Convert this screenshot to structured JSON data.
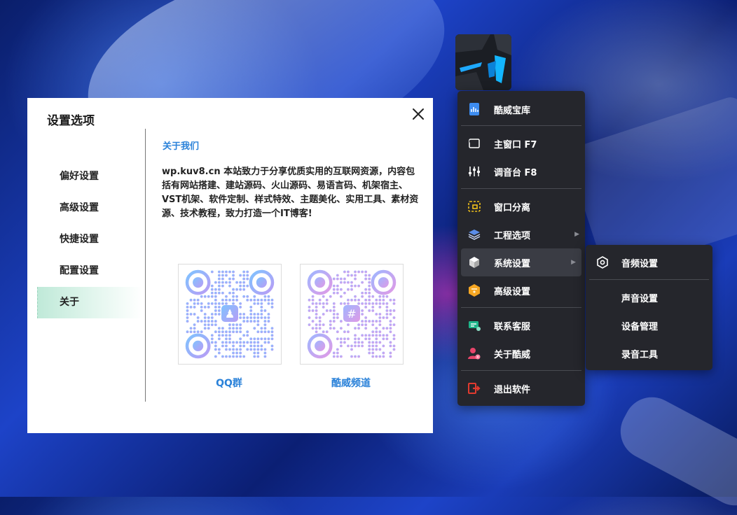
{
  "settings_dialog": {
    "title": "设置选项",
    "nav": [
      "偏好设置",
      "高级设置",
      "快捷设置",
      "配置设置",
      "关于"
    ],
    "active_nav": "关于",
    "about": {
      "heading": "关于我们",
      "text": "wp.kuv8.cn 本站致力于分享优质实用的互联网资源，内容包括有网站搭建、建站源码、火山源码、易语言码、机架宿主、VST机架、软件定制、样式特效、主题美化、实用工具、素材资源、技术教程，致力打造一个IT博客!",
      "qr_codes": [
        {
          "label": "QQ群",
          "icon": "qq-penguin-icon"
        },
        {
          "label": "酷威频道",
          "icon": "hash-channel-icon"
        }
      ]
    }
  },
  "context_menu": {
    "items": {
      "library": "酷威宝库",
      "main_window": "主窗口 F7",
      "mixer": "调音台 F8",
      "window_split": "窗口分离",
      "project_options": "工程选项",
      "system_settings": "系统设置",
      "advanced_settings": "高级设置",
      "contact_support": "联系客服",
      "about": "关于酷威",
      "exit": "退出软件"
    },
    "highlighted": "系统设置"
  },
  "submenu": {
    "items": {
      "audio_settings": "音频设置",
      "sound_settings": "声音设置",
      "device_manager": "设备管理",
      "recording_tools": "录音工具"
    }
  },
  "colors": {
    "accent_blue": "#2b82d9",
    "menu_bg": "#25262c",
    "active_nav_green": "#bfe9d8",
    "exit_red": "#e03a2f"
  }
}
